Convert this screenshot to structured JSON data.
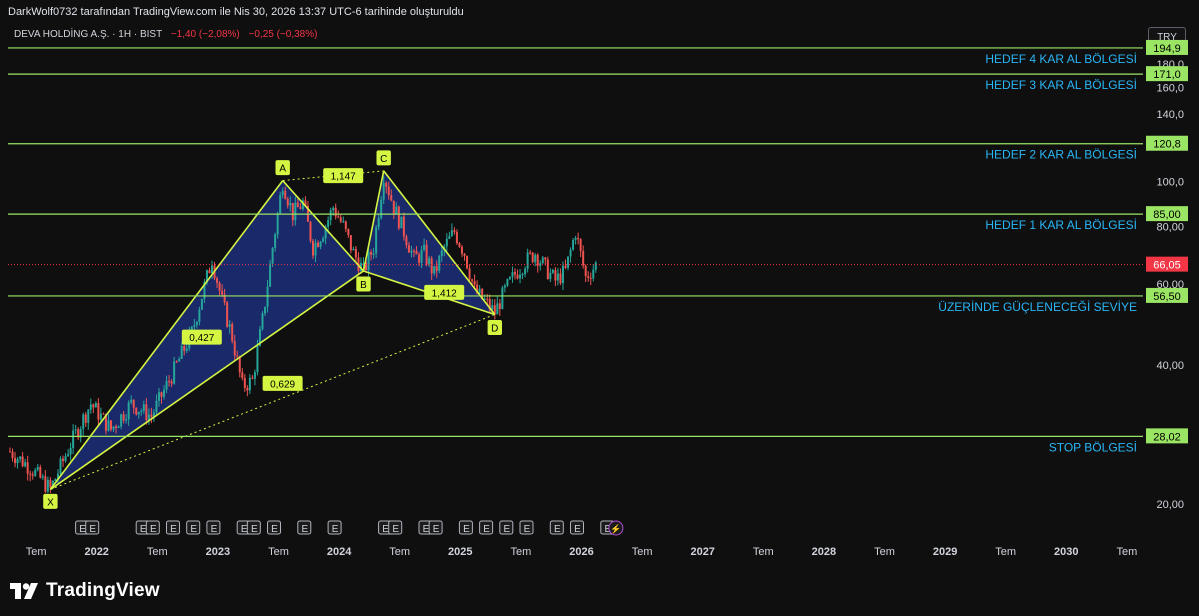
{
  "header": {
    "creation_note": "DarkWolf0732 tarafından TradingView.com ile Nis 30, 2026 13:37 UTC-6 tarihinde oluşturuldu",
    "symbol_line": "DEVA HOLDİNG A.Ş. · 1H · BIST",
    "change_abs": "−1,40 (−2,08%)",
    "change_pct": "−0,25 (−0,38%)",
    "currency_button": "TRY"
  },
  "footer": {
    "brand": "TradingView",
    "logo_icon": "tradingview-logo-icon"
  },
  "colors": {
    "background": "#0f0f0f",
    "level_line": "#9be564",
    "harmonic_fill": "#1c2e7a",
    "harmonic_stroke": "#d4f542",
    "label_text": "#29b6f6",
    "current_price": "#f23645",
    "candle_up": "#26a69a",
    "candle_down": "#ef5350"
  },
  "chart_data": {
    "type": "candlestick",
    "symbol": "DEVA HOLDİNG A.Ş.",
    "interval": "1H",
    "exchange": "BIST",
    "y_scale": "log",
    "ylim": [
      18,
      210
    ],
    "y_ticks": [
      20.0,
      40.0,
      60.0,
      80.0,
      100.0,
      120.0,
      140.0,
      160.0,
      180.0
    ],
    "y_tick_labels": [
      "20,00",
      "40,00",
      "60,00",
      "80,00",
      "100,0",
      "120,0",
      "140,0",
      "160,0",
      "180,0"
    ],
    "x_range": [
      "2021-06",
      "2030-12"
    ],
    "x_ticks": [
      {
        "date": "2021-07",
        "label": "Tem"
      },
      {
        "date": "2022-01",
        "label": "2022"
      },
      {
        "date": "2022-07",
        "label": "Tem"
      },
      {
        "date": "2023-01",
        "label": "2023"
      },
      {
        "date": "2023-07",
        "label": "Tem"
      },
      {
        "date": "2024-01",
        "label": "2024"
      },
      {
        "date": "2024-07",
        "label": "Tem"
      },
      {
        "date": "2025-01",
        "label": "2025"
      },
      {
        "date": "2025-07",
        "label": "Tem"
      },
      {
        "date": "2026-01",
        "label": "2026"
      },
      {
        "date": "2026-07",
        "label": "Tem"
      },
      {
        "date": "2027-01",
        "label": "2027"
      },
      {
        "date": "2027-07",
        "label": "Tem"
      },
      {
        "date": "2028-01",
        "label": "2028"
      },
      {
        "date": "2028-07",
        "label": "Tem"
      },
      {
        "date": "2029-01",
        "label": "2029"
      },
      {
        "date": "2029-07",
        "label": "Tem"
      },
      {
        "date": "2030-01",
        "label": "2030"
      },
      {
        "date": "2030-07",
        "label": "Tem"
      }
    ],
    "current_price": {
      "value": 66.05,
      "label": "66,05"
    },
    "levels": [
      {
        "value": 194.9,
        "label": "194,9",
        "text": "HEDEF 4 KAR AL BÖLGESİ"
      },
      {
        "value": 171.0,
        "label": "171,0",
        "text": "HEDEF 3 KAR AL BÖLGESİ"
      },
      {
        "value": 120.8,
        "label": "120,8",
        "text": "HEDEF 2 KAR AL BÖLGESİ"
      },
      {
        "value": 85.0,
        "label": "85,00",
        "text": "HEDEF 1 KAR AL BÖLGESİ"
      },
      {
        "value": 56.5,
        "label": "56,50",
        "text": "ÜZERİNDE GÜÇLENECEĞİ SEVİYE"
      },
      {
        "value": 28.02,
        "label": "28,02",
        "text": "STOP BÖLGESİ"
      }
    ],
    "harmonic_pattern": {
      "points": [
        {
          "name": "X",
          "date": "2021-10",
          "price": 21.5
        },
        {
          "name": "A",
          "date": "2023-09",
          "price": 100.5
        },
        {
          "name": "B",
          "date": "2024-05",
          "price": 64.0
        },
        {
          "name": "C",
          "date": "2024-07",
          "price": 105.5
        },
        {
          "name": "D",
          "date": "2025-06",
          "price": 51.5
        }
      ],
      "ratios": [
        {
          "label": "0,427",
          "date": "2022-12",
          "price": 46.0
        },
        {
          "label": "1,147",
          "date": "2024-02",
          "price": 103.0
        },
        {
          "label": "0,629",
          "date": "2023-08",
          "price": 36.5
        },
        {
          "label": "1,412",
          "date": "2024-12",
          "price": 57.5
        }
      ]
    },
    "price_path": [
      {
        "date": "2021-06",
        "price": 26
      },
      {
        "date": "2021-08",
        "price": 24
      },
      {
        "date": "2021-10",
        "price": 21.5
      },
      {
        "date": "2021-12",
        "price": 27
      },
      {
        "date": "2022-02",
        "price": 33
      },
      {
        "date": "2022-04",
        "price": 29
      },
      {
        "date": "2022-06",
        "price": 33
      },
      {
        "date": "2022-08",
        "price": 31
      },
      {
        "date": "2022-10",
        "price": 38
      },
      {
        "date": "2022-12",
        "price": 47
      },
      {
        "date": "2023-02",
        "price": 68
      },
      {
        "date": "2023-03",
        "price": 55
      },
      {
        "date": "2023-04",
        "price": 46
      },
      {
        "date": "2023-05",
        "price": 36
      },
      {
        "date": "2023-06",
        "price": 37
      },
      {
        "date": "2023-07",
        "price": 50
      },
      {
        "date": "2023-08",
        "price": 72
      },
      {
        "date": "2023-09",
        "price": 100
      },
      {
        "date": "2023-10",
        "price": 85
      },
      {
        "date": "2023-11",
        "price": 90
      },
      {
        "date": "2023-12",
        "price": 72
      },
      {
        "date": "2024-01",
        "price": 78
      },
      {
        "date": "2024-02",
        "price": 88
      },
      {
        "date": "2024-03",
        "price": 80
      },
      {
        "date": "2024-04",
        "price": 70
      },
      {
        "date": "2024-05",
        "price": 64
      },
      {
        "date": "2024-06",
        "price": 72
      },
      {
        "date": "2024-07",
        "price": 104
      },
      {
        "date": "2024-08",
        "price": 88
      },
      {
        "date": "2024-09",
        "price": 78
      },
      {
        "date": "2024-10",
        "price": 68
      },
      {
        "date": "2024-11",
        "price": 70
      },
      {
        "date": "2024-12",
        "price": 63
      },
      {
        "date": "2025-01",
        "price": 72
      },
      {
        "date": "2025-02",
        "price": 78
      },
      {
        "date": "2025-03",
        "price": 70
      },
      {
        "date": "2025-04",
        "price": 58
      },
      {
        "date": "2025-05",
        "price": 55
      },
      {
        "date": "2025-06",
        "price": 52
      },
      {
        "date": "2025-07",
        "price": 58
      },
      {
        "date": "2025-08",
        "price": 63
      },
      {
        "date": "2025-09",
        "price": 67
      },
      {
        "date": "2025-10",
        "price": 70
      },
      {
        "date": "2025-11",
        "price": 65
      },
      {
        "date": "2025-12",
        "price": 61
      },
      {
        "date": "2026-01",
        "price": 64
      },
      {
        "date": "2026-02",
        "price": 78
      },
      {
        "date": "2026-03",
        "price": 62
      },
      {
        "date": "2026-04",
        "price": 66
      }
    ],
    "event_markers": {
      "label": "E",
      "dates": [
        "2021-12",
        "2022-01",
        "2022-06",
        "2022-07",
        "2022-09",
        "2022-11",
        "2023-01",
        "2023-04",
        "2023-05",
        "2023-07",
        "2023-10",
        "2024-01",
        "2024-06",
        "2024-07",
        "2024-10",
        "2024-11",
        "2025-02",
        "2025-04",
        "2025-06",
        "2025-08",
        "2025-11",
        "2026-01",
        "2026-04"
      ],
      "split_marker_date": "2026-05"
    }
  }
}
